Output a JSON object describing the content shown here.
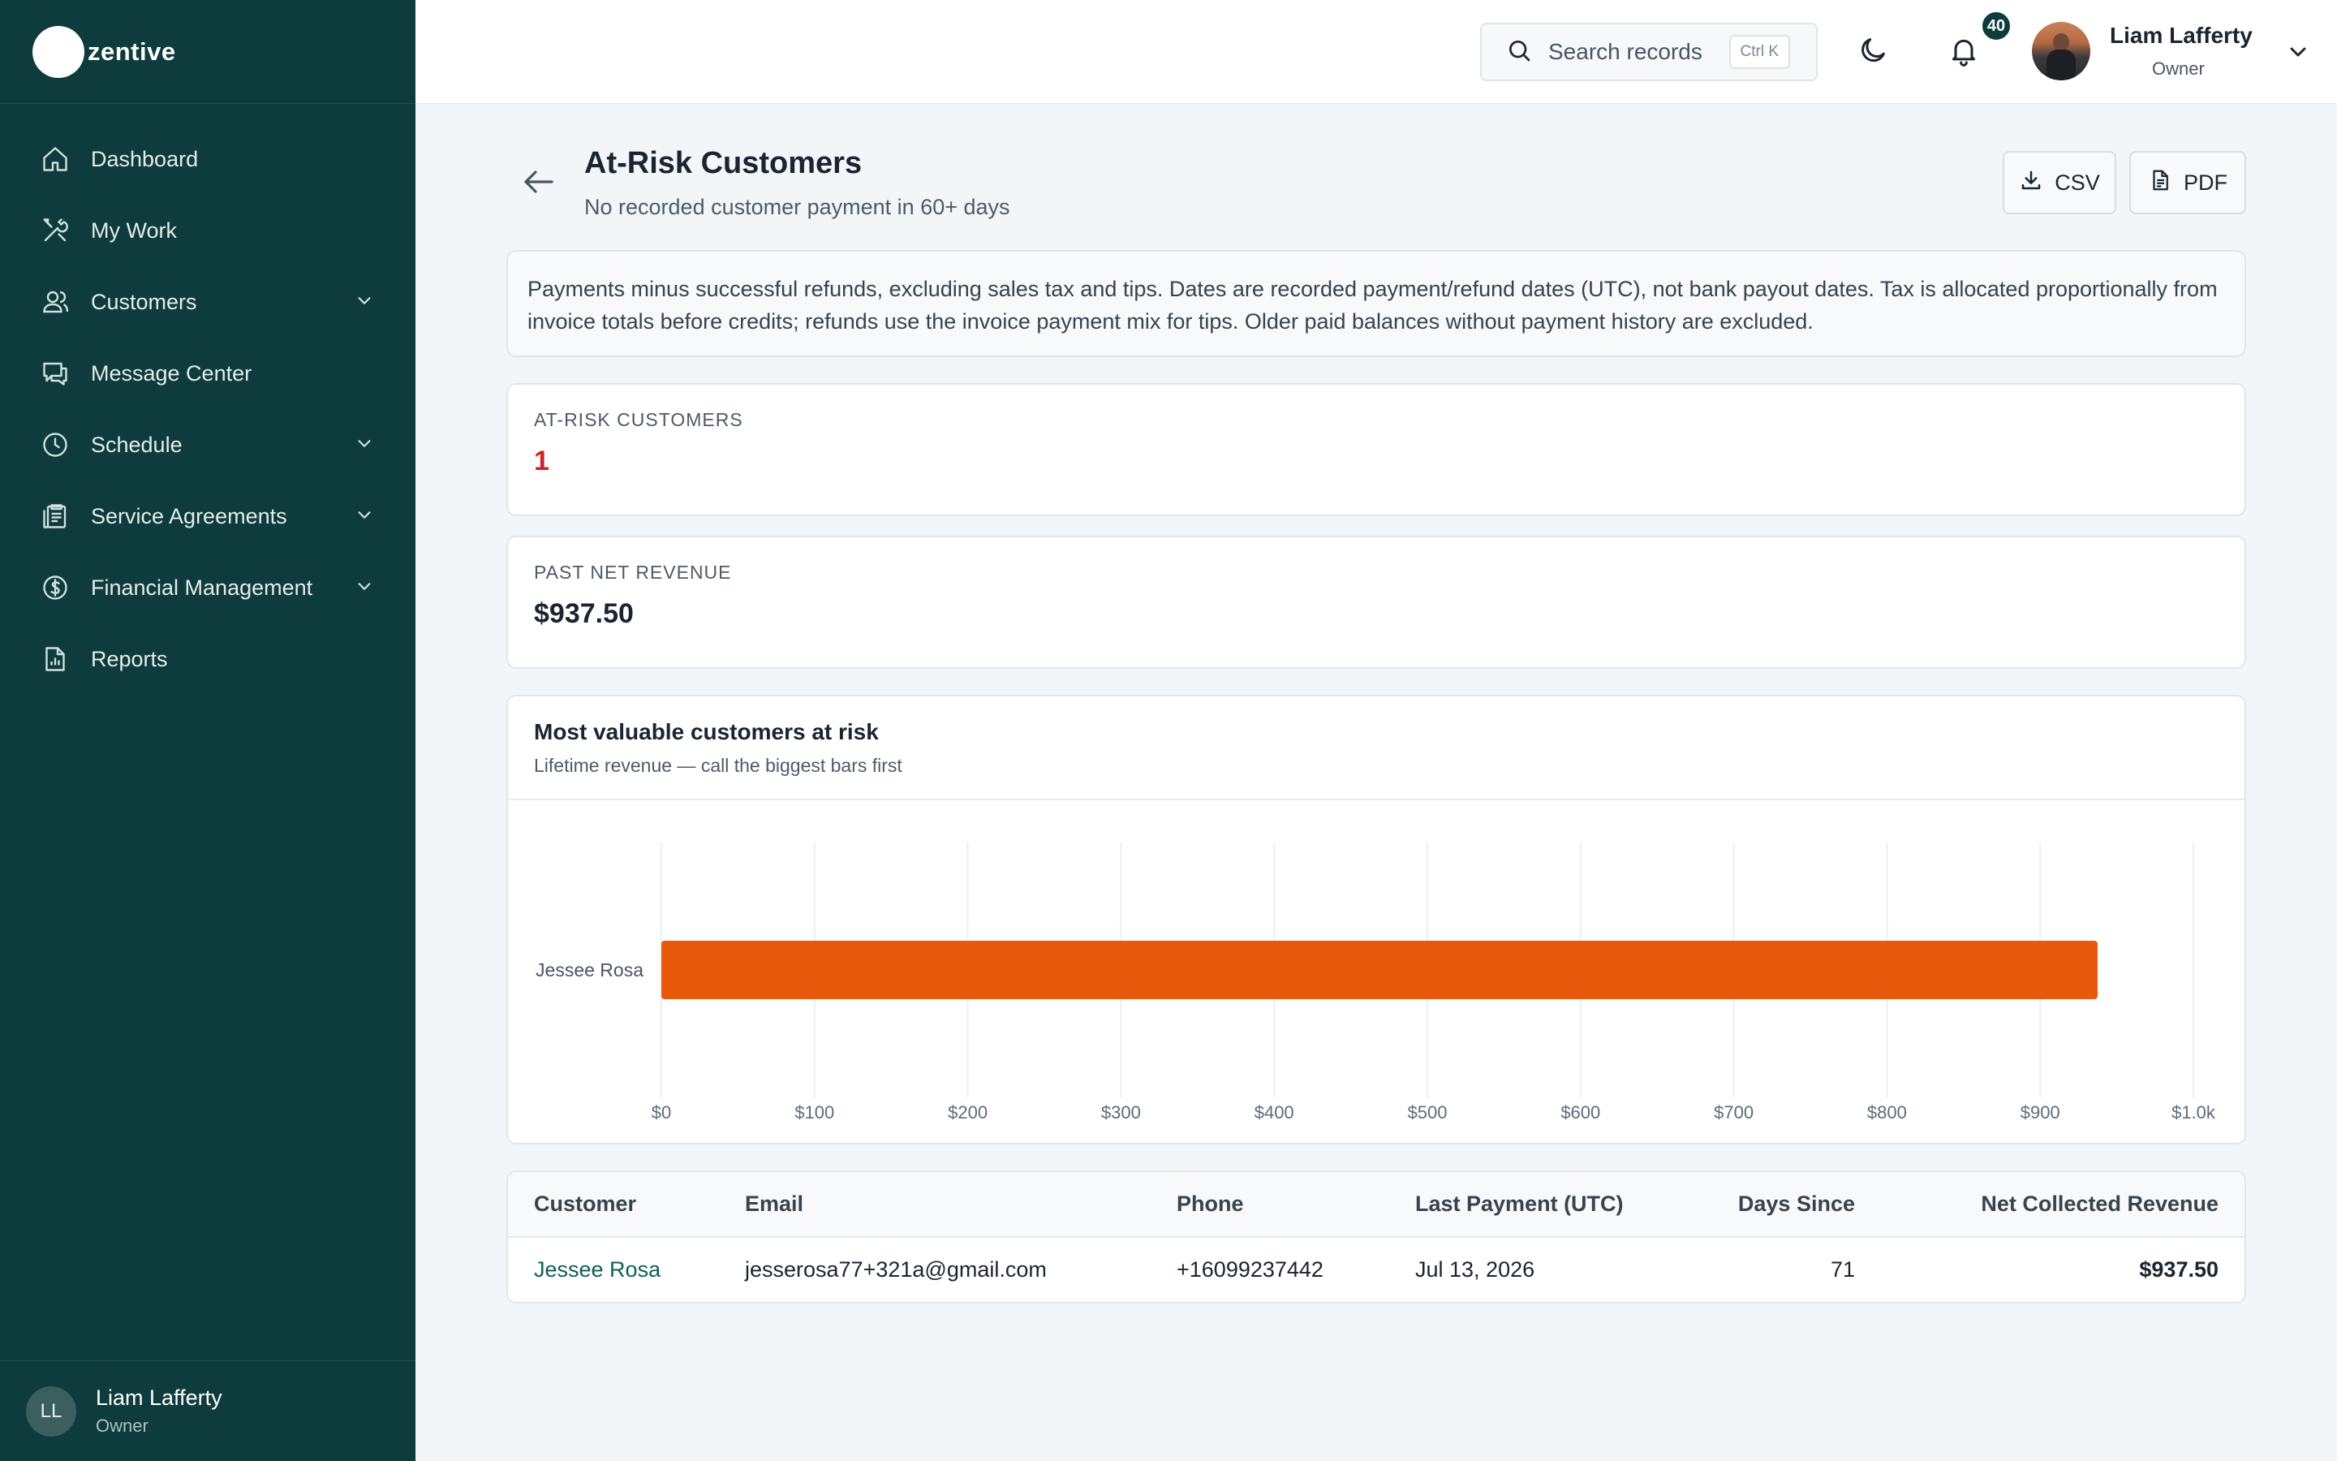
{
  "brand": {
    "name": "zentive"
  },
  "sidebar": {
    "items": [
      {
        "label": "Dashboard",
        "icon": "home-icon",
        "expandable": false
      },
      {
        "label": "My Work",
        "icon": "tools-icon",
        "expandable": false
      },
      {
        "label": "Customers",
        "icon": "users-icon",
        "expandable": true
      },
      {
        "label": "Message Center",
        "icon": "chat-icon",
        "expandable": false
      },
      {
        "label": "Schedule",
        "icon": "clock-icon",
        "expandable": true
      },
      {
        "label": "Service Agreements",
        "icon": "clipboard-icon",
        "expandable": true
      },
      {
        "label": "Financial Management",
        "icon": "dollar-icon",
        "expandable": true
      },
      {
        "label": "Reports",
        "icon": "report-icon",
        "expandable": false
      }
    ],
    "user": {
      "initials": "LL",
      "name": "Liam Lafferty",
      "role": "Owner"
    }
  },
  "topbar": {
    "search_placeholder": "Search records",
    "shortcut": "Ctrl K",
    "notification_count": "40",
    "user_name": "Liam Lafferty",
    "user_role": "Owner"
  },
  "page": {
    "title": "At-Risk Customers",
    "subtitle": "No recorded customer payment in 60+ days",
    "csv_label": "CSV",
    "pdf_label": "PDF",
    "note": "Payments minus successful refunds, excluding sales tax and tips. Dates are recorded payment/refund dates (UTC), not bank payout dates. Tax is allocated proportionally from invoice totals before credits; refunds use the invoice payment mix for tips. Older paid balances without payment history are excluded."
  },
  "stats": {
    "at_risk_label": "AT-RISK CUSTOMERS",
    "at_risk_value": "1",
    "revenue_label": "PAST NET REVENUE",
    "revenue_value": "$937.50"
  },
  "chart": {
    "title": "Most valuable customers at risk",
    "subtitle": "Lifetime revenue — call the biggest bars first"
  },
  "chart_data": {
    "type": "bar",
    "orientation": "horizontal",
    "categories": [
      "Jessee Rosa"
    ],
    "values": [
      937.5
    ],
    "xlim": [
      0,
      1000
    ],
    "xticks": [
      0,
      100,
      200,
      300,
      400,
      500,
      600,
      700,
      800,
      900,
      1000
    ],
    "xtick_labels": [
      "$0",
      "$100",
      "$200",
      "$300",
      "$400",
      "$500",
      "$600",
      "$700",
      "$800",
      "$900",
      "$1.0k"
    ],
    "bar_color": "#e8590c",
    "grid": true
  },
  "table": {
    "headers": [
      "Customer",
      "Email",
      "Phone",
      "Last Payment (UTC)",
      "Days Since",
      "Net Collected Revenue"
    ],
    "rows": [
      [
        "Jessee Rosa",
        "jesserosa77+321a@gmail.com",
        "+16099237442",
        "Jul 13, 2026",
        "71",
        "$937.50"
      ]
    ]
  },
  "colors": {
    "sidebar": "#0e3b3c",
    "accent_bar": "#e8590c",
    "danger": "#d02226"
  }
}
